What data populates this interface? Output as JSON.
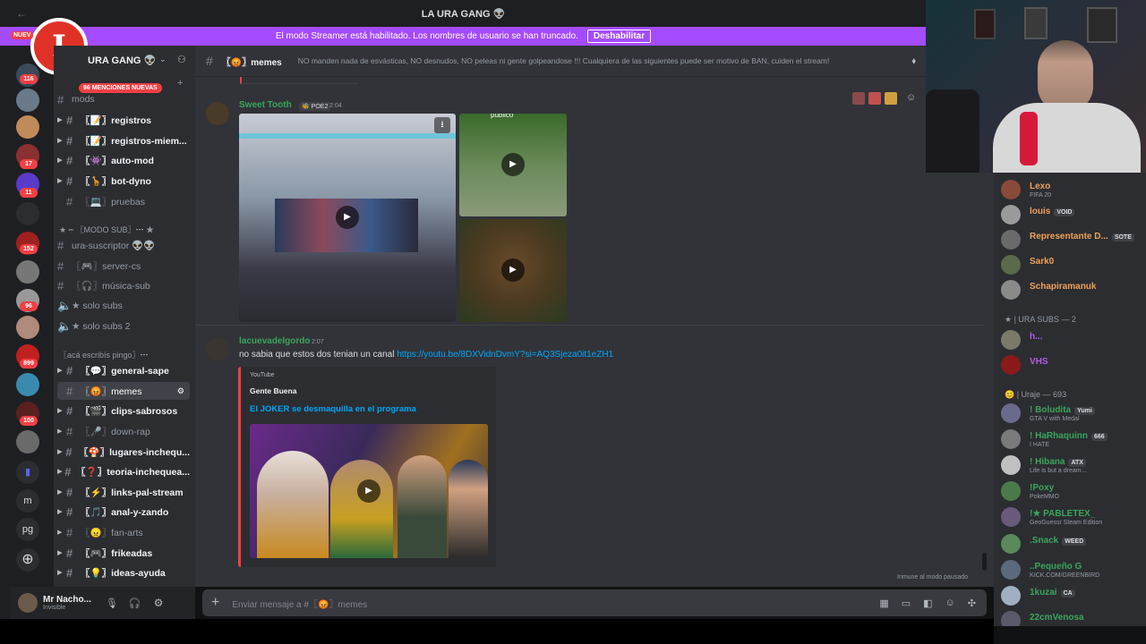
{
  "window": {
    "title": "LA URA GANG 👽",
    "back": "←"
  },
  "banner": {
    "text": "El modo Streamer está habilitado. Los nombres de usuario se han truncado.",
    "button": "Deshabilitar"
  },
  "overlay_logo": {
    "letter": "I"
  },
  "server": {
    "name": "URA GANG 👽",
    "new_label": "NUEV",
    "mentions": "96 MENCIONES NUEVAS"
  },
  "guild_badges": [
    "116",
    "17",
    "11",
    "152",
    "96",
    "899",
    "100"
  ],
  "guild_letters": [
    "m",
    "pg"
  ],
  "categories": {
    "modo_sub": "★ ┅ 〖MODO SUB〗┅ ★",
    "aca": "〖acá escribís pingo〗┅"
  },
  "channels": [
    {
      "label": "mods",
      "top": "mods"
    },
    {
      "label": "〖📝〗registros"
    },
    {
      "label": "〖📝〗registros-miem..."
    },
    {
      "label": "〖👾〗auto-mod"
    },
    {
      "label": "〖🦒〗bot-dyno"
    },
    {
      "label": "〖💻〗pruebas"
    },
    {
      "label": "ura-suscriptor 👽👽"
    },
    {
      "label": "〖🎮〗server-cs"
    },
    {
      "label": "〖🎧〗música-sub"
    },
    {
      "label": "★ solo subs"
    },
    {
      "label": "★ solo subs 2"
    },
    {
      "label": "〖💬〗general-sape"
    },
    {
      "label": "〖😡〗memes"
    },
    {
      "label": "〖🎬〗clips-sabrosos"
    },
    {
      "label": "〖🎤〗down-rap"
    },
    {
      "label": "〖🍄〗lugares-inchequ..."
    },
    {
      "label": "〖❓〗teoria-inchequea..."
    },
    {
      "label": "〖⚡〗links-pal-stream"
    },
    {
      "label": "〖🎵〗anal-y-zando"
    },
    {
      "label": "〖😠〗fan-arts"
    },
    {
      "label": "〖🎮〗frikeadas"
    },
    {
      "label": "〖💡〗ideas-ayuda"
    }
  ],
  "user": {
    "name": "Mr Nacho...",
    "status": "Invisible"
  },
  "chat_header": {
    "channel": "〖😡〗memes",
    "topic": "NO manden nada de esvásticas, NO desnudos, NO peleas ni gente golpeandose !!! Cualquiera de las siguientes puede ser motivo de BAN, cuiden el stream!"
  },
  "messages": [
    {
      "author": "Sweet Tooth",
      "tag": "🐝 POE2",
      "time": "2:04",
      "overlay_text": "publico"
    },
    {
      "author": "lacuevadelgordo",
      "time": "2:07",
      "text": "no sabia que estos dos tenian un canal",
      "link": "https://youtu.be/8DXVidnDvmY?si=AQ3Sjeza0it1eZH1",
      "embed": {
        "provider": "YouTube",
        "author": "Gente Buena",
        "title": "El JOKER se desmaquilla en el programa"
      }
    }
  ],
  "slowmode": "Inmune al modo pausado",
  "input": {
    "placeholder": "Enviar mensaje a #〖😡〗memes"
  },
  "members": {
    "online": [
      {
        "name": "Lexo",
        "sub": "FIFA 20",
        "color": "#f0a15b"
      },
      {
        "name": "louis",
        "tag": "VOID",
        "color": "#f0a15b"
      },
      {
        "name": "Representante D...",
        "tag": "SOTE",
        "color": "#f0a15b"
      },
      {
        "name": "Sark0",
        "color": "#f0a15b"
      },
      {
        "name": "Schapiramanuk",
        "color": "#f0a15b"
      }
    ],
    "subs_header": "★ | URA SUBS — 2",
    "subs": [
      {
        "name": "h...",
        "color": "#b75ae8"
      },
      {
        "name": "VHS",
        "color": "#b75ae8"
      }
    ],
    "uraje_header": "😊 | Uraje — 693",
    "uraje": [
      {
        "name": "! Boludita",
        "tag": "Yumi",
        "sub": "GTA V with Medal",
        "color": "#3ba55c"
      },
      {
        "name": "! HaRhaquinn",
        "tag": "666",
        "sub": "I HATE",
        "color": "#3ba55c"
      },
      {
        "name": "! Hibana",
        "tag": "ATX",
        "sub": "Life is but a dream...",
        "color": "#3ba55c"
      },
      {
        "name": "!Poxy",
        "sub": "PokeMMO",
        "color": "#3ba55c"
      },
      {
        "name": "!★ PABLETEX_",
        "sub": "GeoGuessr Steam Edition",
        "color": "#3ba55c"
      },
      {
        "name": ".Snack",
        "tag": "WEED",
        "color": "#3ba55c"
      },
      {
        "name": "..Pequeño G",
        "sub": "KICK.COM/GREENBIRD",
        "color": "#3ba55c"
      },
      {
        "name": "1kuzai",
        "tag": "CA",
        "color": "#3ba55c"
      },
      {
        "name": "22cmVenosa",
        "color": "#3ba55c"
      }
    ]
  },
  "colors": {
    "accent": "#a44bff",
    "link": "#00a8fc",
    "sweet_tooth": "#3ba55c",
    "lacueva": "#3ba55c"
  }
}
